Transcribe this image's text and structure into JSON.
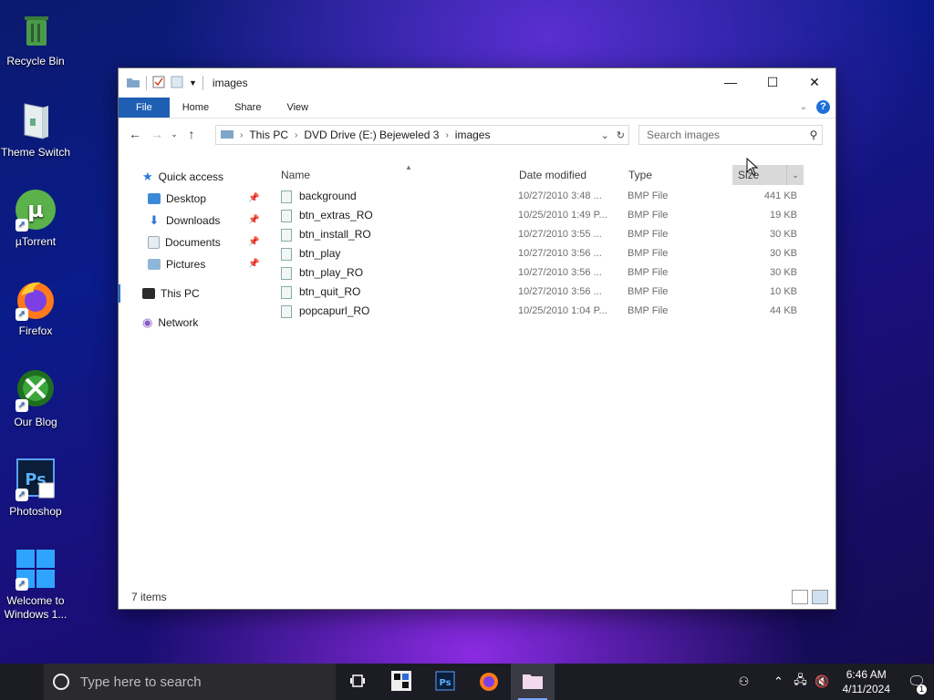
{
  "desktop": {
    "icons": [
      {
        "label": "Recycle Bin"
      },
      {
        "label": "Theme Switch"
      },
      {
        "label": "µTorrent"
      },
      {
        "label": "Firefox"
      },
      {
        "label": "Our Blog"
      },
      {
        "label": "Photoshop"
      },
      {
        "label": "Welcome to Windows 1..."
      }
    ]
  },
  "window": {
    "title": "images",
    "controls": {
      "minimize": "—",
      "maximize": "☐",
      "close": "✕"
    },
    "ribbon": {
      "file": "File",
      "home": "Home",
      "share": "Share",
      "view": "View",
      "help": "?"
    },
    "address": {
      "segments": [
        "This PC",
        "DVD Drive (E:) Bejeweled 3",
        "images"
      ]
    },
    "search": {
      "placeholder": "Search images"
    },
    "sidebar": {
      "quick_access": "Quick access",
      "desktop": "Desktop",
      "downloads": "Downloads",
      "documents": "Documents",
      "pictures": "Pictures",
      "this_pc": "This PC",
      "network": "Network"
    },
    "columns": {
      "name": "Name",
      "date": "Date modified",
      "type": "Type",
      "size": "Size"
    },
    "files": [
      {
        "name": "background",
        "date": "10/27/2010 3:48 ...",
        "type": "BMP File",
        "size": "441 KB"
      },
      {
        "name": "btn_extras_RO",
        "date": "10/25/2010 1:49 P...",
        "type": "BMP File",
        "size": "19 KB"
      },
      {
        "name": "btn_install_RO",
        "date": "10/27/2010 3:55 ...",
        "type": "BMP File",
        "size": "30 KB"
      },
      {
        "name": "btn_play",
        "date": "10/27/2010 3:56 ...",
        "type": "BMP File",
        "size": "30 KB"
      },
      {
        "name": "btn_play_RO",
        "date": "10/27/2010 3:56 ...",
        "type": "BMP File",
        "size": "30 KB"
      },
      {
        "name": "btn_quit_RO",
        "date": "10/27/2010 3:56 ...",
        "type": "BMP File",
        "size": "10 KB"
      },
      {
        "name": "popcapurl_RO",
        "date": "10/25/2010 1:04 P...",
        "type": "BMP File",
        "size": "44 KB"
      }
    ],
    "status": {
      "count": "7 items"
    }
  },
  "taskbar": {
    "search_placeholder": "Type here to search",
    "clock": {
      "time": "6:46 AM",
      "date": "4/11/2024"
    },
    "notification_count": "1"
  },
  "colors": {
    "accent": "#1e5fb4",
    "taskbar": "#1c1c24"
  }
}
